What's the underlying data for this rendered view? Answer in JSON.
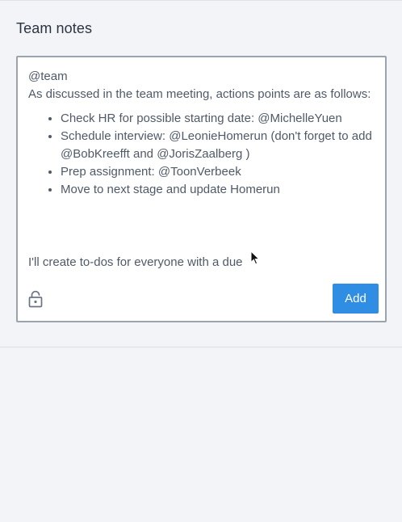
{
  "panel": {
    "title": "Team notes"
  },
  "editor": {
    "mention_line": "@team",
    "intro": "As discussed in the team meeting, actions points are as follows:",
    "items": [
      {
        "text": "Check HR for possible starting date: @MichelleYuen"
      },
      {
        "text": "Schedule interview: @LeonieHomerun (don't forget to add @BobKreefft and @JorisZaalberg )"
      },
      {
        "text": "Prep assignment: @ToonVerbeek"
      },
      {
        "text": "Move to next stage and update Homerun"
      }
    ],
    "closing": "I'll create to-dos for everyone with a due"
  },
  "toolbar": {
    "lock_icon": "lock-icon",
    "add_label": "Add"
  },
  "colors": {
    "accent": "#2f8de4",
    "background": "#f3f4f7",
    "editor_border": "#9aa3ae"
  }
}
